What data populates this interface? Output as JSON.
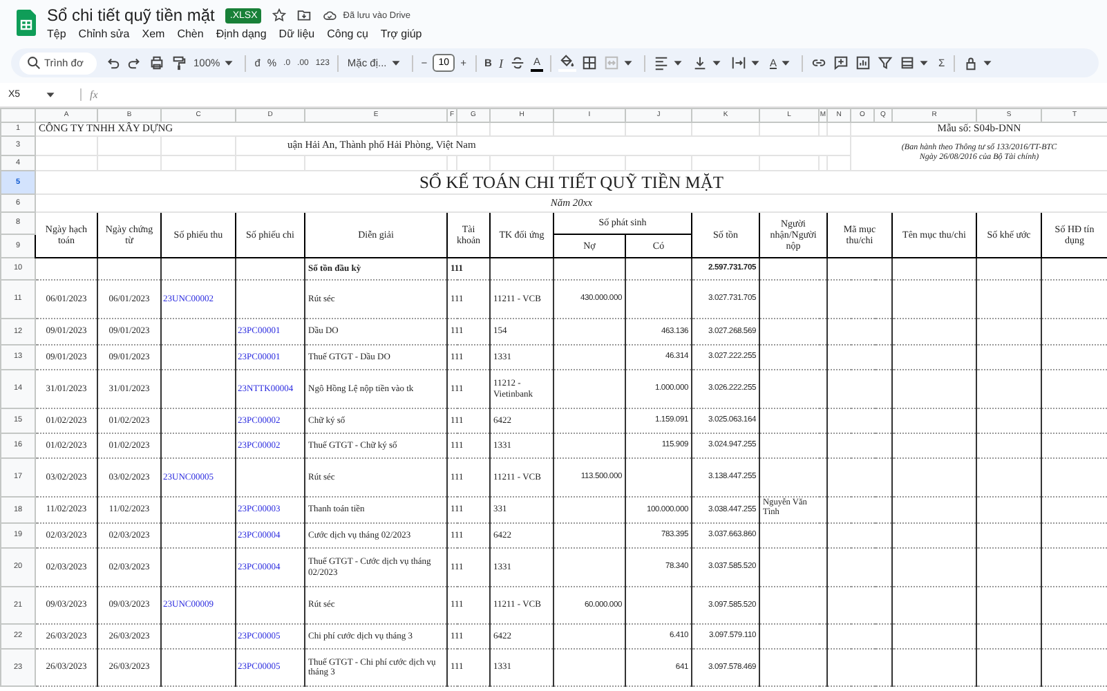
{
  "app": {
    "title": "Sổ chi tiết quỹ tiền mặt",
    "badge": ".XLSX",
    "save_status": "Đã lưu vào Drive",
    "menu": [
      "Tệp",
      "Chỉnh sửa",
      "Xem",
      "Chèn",
      "Định dạng",
      "Dữ liệu",
      "Công cụ",
      "Trợ giúp"
    ]
  },
  "toolbar": {
    "search_placeholder": "Trình đơ",
    "zoom": "100%",
    "currency": "đ",
    "percent": "%",
    "decrease_decimal": ".0",
    "increase_decimal": ".00",
    "number_format": "123",
    "font": "Mặc đị...",
    "minus": "−",
    "font_size": "10",
    "plus": "+",
    "bold": "B",
    "italic": "I",
    "text_color": "A",
    "rotate": "A",
    "function": "Σ"
  },
  "formula_bar": {
    "cell_ref": "X5",
    "fx": "fx"
  },
  "sheet": {
    "column_letters": [
      "A",
      "B",
      "C",
      "D",
      "E",
      "F",
      "G",
      "H",
      "I",
      "J",
      "K",
      "L",
      "M",
      "N",
      "O",
      "Q",
      "R",
      "S",
      "T"
    ],
    "row_headers": [
      {
        "label": "1",
        "selected": false
      },
      {
        "label": "3",
        "selected": false
      },
      {
        "label": "4",
        "selected": false
      },
      {
        "label": "5",
        "selected": true
      },
      {
        "label": "6",
        "selected": false
      },
      {
        "label": "8",
        "selected": false
      },
      {
        "label": "9",
        "selected": false
      },
      {
        "label": "10",
        "selected": false
      },
      {
        "label": "11",
        "selected": false
      },
      {
        "label": "12",
        "selected": false
      },
      {
        "label": "13",
        "selected": false
      },
      {
        "label": "14",
        "selected": false
      },
      {
        "label": "15",
        "selected": false
      },
      {
        "label": "16",
        "selected": false
      },
      {
        "label": "17",
        "selected": false
      },
      {
        "label": "18",
        "selected": false
      },
      {
        "label": "19",
        "selected": false
      },
      {
        "label": "20",
        "selected": false
      },
      {
        "label": "21",
        "selected": false
      },
      {
        "label": "22",
        "selected": false
      },
      {
        "label": "23",
        "selected": false
      }
    ],
    "company": "CÔNG TY TNHH XÂY DỰNG",
    "address": "uận Hải An, Thành phố Hải Phòng, Việt Nam",
    "form_code": "Mẫu số: S04b-DNN",
    "form_note": [
      "(Ban hành theo Thông tư số 133/2016/TT-BTC",
      "Ngày 26/08/2016 của Bộ Tài chính)"
    ],
    "title": "SỔ KẾ TOÁN CHI TIẾT QUỸ TIỀN MẶT",
    "subtitle": "Năm 20xx",
    "columns": [
      {
        "label": "Ngày hạch toán"
      },
      {
        "label": "Ngày chứng từ"
      },
      {
        "label": "Số phiếu thu"
      },
      {
        "label": "Số phiếu chi"
      },
      {
        "label": "Diễn giải"
      },
      {
        "label": "Tài khoản"
      },
      {
        "label": "TK đối ứng"
      },
      {
        "label": "Số phát sinh",
        "children": [
          {
            "label": "Nợ"
          },
          {
            "label": "Có"
          }
        ]
      },
      {
        "label": "Số tồn"
      },
      {
        "label": "Người nhận/Người nộp"
      },
      {
        "label": "Mã mục thu/chi"
      },
      {
        "label": "Tên mục thu/chi"
      },
      {
        "label": "Số khế ước"
      },
      {
        "label": "Số HĐ tín dụng"
      }
    ],
    "opening": {
      "description": "Số tồn đầu kỳ",
      "account": "111",
      "balance": "2.597.731.705"
    },
    "rows": [
      {
        "posting_date": "06/01/2023",
        "doc_date": "06/01/2023",
        "receipt_no": "23UNC00002",
        "description": "Rút séc",
        "account": "111",
        "contra_account": "11211 - VCB",
        "debit": "430.000.000",
        "balance": "3.027.731.705"
      },
      {
        "posting_date": "09/01/2023",
        "doc_date": "09/01/2023",
        "payment_no": "23PC00001",
        "description": "Dầu DO",
        "account": "111",
        "contra_account": "154",
        "credit": "463.136",
        "balance": "3.027.268.569"
      },
      {
        "posting_date": "09/01/2023",
        "doc_date": "09/01/2023",
        "payment_no": "23PC00001",
        "description": "Thuế GTGT - Dầu DO",
        "account": "111",
        "contra_account": "1331",
        "credit": "46.314",
        "balance": "3.027.222.255"
      },
      {
        "posting_date": "31/01/2023",
        "doc_date": "31/01/2023",
        "payment_no": "23NTTK00004",
        "description": "Ngô Hồng Lệ nộp tiền vào tk",
        "account": "111",
        "contra_account": "11212 - Vietinbank",
        "credit": "1.000.000",
        "balance": "3.026.222.255"
      },
      {
        "posting_date": "01/02/2023",
        "doc_date": "01/02/2023",
        "payment_no": "23PC00002",
        "description": "Chữ ký số",
        "account": "111",
        "contra_account": "6422",
        "credit": "1.159.091",
        "balance": "3.025.063.164"
      },
      {
        "posting_date": "01/02/2023",
        "doc_date": "01/02/2023",
        "payment_no": "23PC00002",
        "description": "Thuế GTGT - Chữ ký số",
        "account": "111",
        "contra_account": "1331",
        "credit": "115.909",
        "balance": "3.024.947.255"
      },
      {
        "posting_date": "03/02/2023",
        "doc_date": "03/02/2023",
        "receipt_no": "23UNC00005",
        "description": "Rút séc",
        "account": "111",
        "contra_account": "11211 - VCB",
        "debit": "113.500.000",
        "balance": "3.138.447.255"
      },
      {
        "posting_date": "11/02/2023",
        "doc_date": "11/02/2023",
        "payment_no": "23PC00003",
        "description": "Thanh toán tiền",
        "account": "111",
        "contra_account": "331",
        "credit": "100.000.000",
        "balance": "3.038.447.255",
        "payer": "Nguyễn Văn Tình"
      },
      {
        "posting_date": "02/03/2023",
        "doc_date": "02/03/2023",
        "payment_no": "23PC00004",
        "description": "Cước dịch vụ tháng 02/2023",
        "account": "111",
        "contra_account": "6422",
        "credit": "783.395",
        "balance": "3.037.663.860"
      },
      {
        "posting_date": "02/03/2023",
        "doc_date": "02/03/2023",
        "payment_no": "23PC00004",
        "description": "Thuế GTGT - Cước dịch vụ tháng 02/2023",
        "account": "111",
        "contra_account": "1331",
        "credit": "78.340",
        "balance": "3.037.585.520"
      },
      {
        "posting_date": "09/03/2023",
        "doc_date": "09/03/2023",
        "receipt_no": "23UNC00009",
        "description": "Rút séc",
        "account": "111",
        "contra_account": "11211 - VCB",
        "debit": "60.000.000",
        "balance": "3.097.585.520"
      },
      {
        "posting_date": "26/03/2023",
        "doc_date": "26/03/2023",
        "payment_no": "23PC00005",
        "description": "Chi phí cước dịch vụ tháng 3",
        "account": "111",
        "contra_account": "6422",
        "credit": "6.410",
        "balance": "3.097.579.110"
      },
      {
        "posting_date": "26/03/2023",
        "doc_date": "26/03/2023",
        "payment_no": "23PC00005",
        "description": "Thuế GTGT - Chi phí cước dịch vụ tháng 3",
        "account": "111",
        "contra_account": "1331",
        "credit": "641",
        "balance": "3.097.578.469"
      }
    ]
  }
}
